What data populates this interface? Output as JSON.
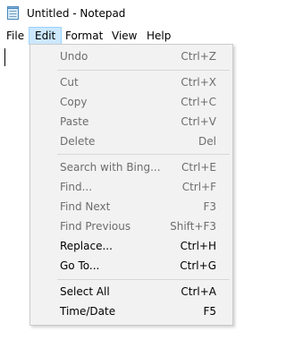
{
  "window": {
    "title": "Untitled - Notepad",
    "app_icon": "notepad-icon"
  },
  "menubar": {
    "items": [
      {
        "label": "File",
        "active": false
      },
      {
        "label": "Edit",
        "active": true
      },
      {
        "label": "Format",
        "active": false
      },
      {
        "label": "View",
        "active": false
      },
      {
        "label": "Help",
        "active": false
      }
    ]
  },
  "edit_menu": {
    "items": [
      {
        "label": "Undo",
        "shortcut": "Ctrl+Z",
        "enabled": false
      },
      {
        "label": "Cut",
        "shortcut": "Ctrl+X",
        "enabled": false
      },
      {
        "label": "Copy",
        "shortcut": "Ctrl+C",
        "enabled": false
      },
      {
        "label": "Paste",
        "shortcut": "Ctrl+V",
        "enabled": false
      },
      {
        "label": "Delete",
        "shortcut": "Del",
        "enabled": false
      },
      {
        "label": "Search with Bing...",
        "shortcut": "Ctrl+E",
        "enabled": false
      },
      {
        "label": "Find...",
        "shortcut": "Ctrl+F",
        "enabled": false
      },
      {
        "label": "Find Next",
        "shortcut": "F3",
        "enabled": false
      },
      {
        "label": "Find Previous",
        "shortcut": "Shift+F3",
        "enabled": false
      },
      {
        "label": "Replace...",
        "shortcut": "Ctrl+H",
        "enabled": true
      },
      {
        "label": "Go To...",
        "shortcut": "Ctrl+G",
        "enabled": true
      },
      {
        "label": "Select All",
        "shortcut": "Ctrl+A",
        "enabled": true
      },
      {
        "label": "Time/Date",
        "shortcut": "F5",
        "enabled": true
      }
    ]
  },
  "colors": {
    "menu_active_bg": "#cce8ff",
    "menu_active_border": "#99d1ff",
    "dropdown_bg": "#f2f2f2",
    "disabled_text": "#6d6d6d"
  }
}
